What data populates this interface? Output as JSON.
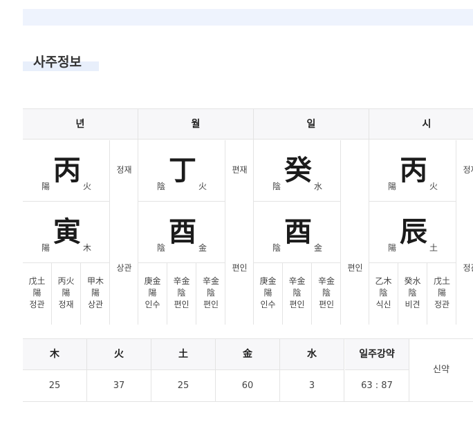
{
  "title": "사주정보",
  "pillars": [
    {
      "header": "년",
      "stem": {
        "hanja": "丙",
        "polarity": "陽",
        "element": "火",
        "ten_god": "정재"
      },
      "branch": {
        "hanja": "寅",
        "polarity": "陽",
        "element": "木",
        "ten_god": "상관"
      },
      "hidden": [
        {
          "stem": "戊土",
          "pol": "陽",
          "god": "정관"
        },
        {
          "stem": "丙火",
          "pol": "陽",
          "god": "정재"
        },
        {
          "stem": "甲木",
          "pol": "陽",
          "god": "상관"
        }
      ]
    },
    {
      "header": "월",
      "stem": {
        "hanja": "丁",
        "polarity": "陰",
        "element": "火",
        "ten_god": "편재"
      },
      "branch": {
        "hanja": "酉",
        "polarity": "陰",
        "element": "金",
        "ten_god": "편인"
      },
      "hidden": [
        {
          "stem": "庚金",
          "pol": "陽",
          "god": "인수"
        },
        {
          "stem": "辛金",
          "pol": "陰",
          "god": "편인"
        },
        {
          "stem": "辛金",
          "pol": "陰",
          "god": "편인"
        }
      ]
    },
    {
      "header": "일",
      "stem": {
        "hanja": "癸",
        "polarity": "陰",
        "element": "水",
        "ten_god": ""
      },
      "branch": {
        "hanja": "酉",
        "polarity": "陰",
        "element": "金",
        "ten_god": "편인"
      },
      "hidden": [
        {
          "stem": "庚金",
          "pol": "陽",
          "god": "인수"
        },
        {
          "stem": "辛金",
          "pol": "陰",
          "god": "편인"
        },
        {
          "stem": "辛金",
          "pol": "陰",
          "god": "편인"
        }
      ]
    },
    {
      "header": "시",
      "stem": {
        "hanja": "丙",
        "polarity": "陽",
        "element": "火",
        "ten_god": "정재"
      },
      "branch": {
        "hanja": "辰",
        "polarity": "陽",
        "element": "土",
        "ten_god": "정관"
      },
      "hidden": [
        {
          "stem": "乙木",
          "pol": "陰",
          "god": "식신"
        },
        {
          "stem": "癸水",
          "pol": "陰",
          "god": "비견"
        },
        {
          "stem": "戊土",
          "pol": "陽",
          "god": "정관"
        }
      ]
    }
  ],
  "ohaeng": {
    "headers": [
      "木",
      "火",
      "土",
      "金",
      "水",
      "일주강약"
    ],
    "values": [
      "25",
      "37",
      "25",
      "60",
      "3",
      "63 : 87"
    ],
    "verdict": "신약"
  }
}
